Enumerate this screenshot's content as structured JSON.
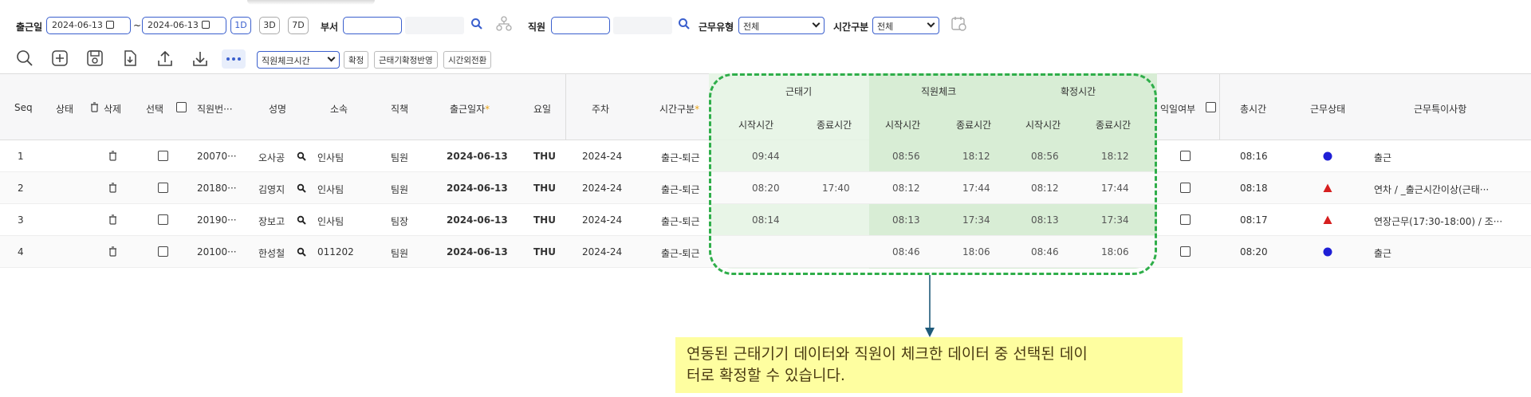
{
  "filters": {
    "date_label": "출근일",
    "date_from": "2024-06-13",
    "tilde": "~",
    "date_to": "2024-06-13",
    "range_buttons": [
      "1D",
      "3D",
      "7D"
    ],
    "dept_label": "부서",
    "employee_label": "직원",
    "work_type_label": "근무유형",
    "work_type_value": "전체",
    "time_type_label": "시간구분",
    "time_type_value": "전체"
  },
  "toolbar": {
    "dropdown_value": "직원체크시간",
    "confirm_button": "확정",
    "apply_button": "근태기확정반영",
    "overtime_button": "시간외전환"
  },
  "table": {
    "headers": {
      "seq": "Seq",
      "status": "상태",
      "delete": "삭제",
      "select": "선택",
      "emp_no": "직원번···",
      "name": "성명",
      "dept": "소속",
      "position": "직책",
      "date": "출근일자",
      "weekday": "요일",
      "week": "주차",
      "time_type": "시간구분",
      "device_group": "근태기",
      "employee_check_group": "직원체크",
      "confirmed_group": "확정시간",
      "start": "시작시간",
      "end": "종료시간",
      "next_day": "익일여부",
      "total": "총시간",
      "work_status": "근무상태",
      "remarks": "근무특이사항"
    },
    "rows": [
      {
        "seq": "1",
        "emp_no": "20070···",
        "name": "오사공",
        "dept": "인사팀",
        "position": "팀원",
        "date": "2024-06-13",
        "weekday": "THU",
        "week": "2024-24",
        "time_type": "출근-퇴근",
        "dev_start": "09:44",
        "dev_end": "",
        "chk_start": "08:56",
        "chk_end": "18:12",
        "cf_start": "08:56",
        "cf_end": "18:12",
        "total": "08:16",
        "status_shape": "circle",
        "status_color": "#1f1fd6",
        "remarks": "출근"
      },
      {
        "seq": "2",
        "emp_no": "20180···",
        "name": "김영지",
        "dept": "인사팀",
        "position": "팀원",
        "date": "2024-06-13",
        "weekday": "THU",
        "week": "2024-24",
        "time_type": "출근-퇴근",
        "dev_start": "08:20",
        "dev_end": "17:40",
        "chk_start": "08:12",
        "chk_end": "17:44",
        "cf_start": "08:12",
        "cf_end": "17:44",
        "total": "08:18",
        "status_shape": "triangle",
        "status_color": "#d61f1f",
        "remarks": "연차 / _출근시간이상(근태···"
      },
      {
        "seq": "3",
        "emp_no": "20190···",
        "name": "장보고",
        "dept": "인사팀",
        "position": "팀장",
        "date": "2024-06-13",
        "weekday": "THU",
        "week": "2024-24",
        "time_type": "출근-퇴근",
        "dev_start": "08:14",
        "dev_end": "",
        "chk_start": "08:13",
        "chk_end": "17:34",
        "cf_start": "08:13",
        "cf_end": "17:34",
        "total": "08:17",
        "status_shape": "triangle",
        "status_color": "#d61f1f",
        "remarks": "연장근무(17:30-18:00) / 조···"
      },
      {
        "seq": "4",
        "emp_no": "20100···",
        "name": "한성철",
        "dept": "011202",
        "position": "팀원",
        "date": "2024-06-13",
        "weekday": "THU",
        "week": "2024-24",
        "time_type": "출근-퇴근",
        "dev_start": "",
        "dev_end": "",
        "chk_start": "08:46",
        "chk_end": "18:06",
        "cf_start": "08:46",
        "cf_end": "18:06",
        "total": "08:20",
        "status_shape": "circle",
        "status_color": "#1f1fd6",
        "remarks": "출근"
      }
    ]
  },
  "callout": {
    "text_line1": "연동된 근태기기 데이터와 직원이 체크한 데이터 중 선택된 데이",
    "text_line2": "터로 확정할 수 있습니다."
  },
  "colors": {
    "accent": "#3a5fcd",
    "highlight_border": "#2fae4a",
    "highlight_fill": "#e6f4e4",
    "callout_bg": "#fefea0",
    "arrow": "#1f5a7a"
  }
}
